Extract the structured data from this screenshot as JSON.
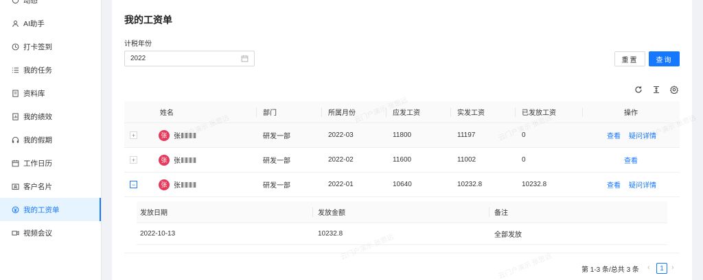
{
  "sidebar": {
    "items": [
      {
        "label": "动态",
        "icon": "activity-icon"
      },
      {
        "label": "AI助手",
        "icon": "user-icon"
      },
      {
        "label": "打卡签到",
        "icon": "clock-icon"
      },
      {
        "label": "我的任务",
        "icon": "list-icon"
      },
      {
        "label": "资料库",
        "icon": "document-icon"
      },
      {
        "label": "我的绩效",
        "icon": "report-icon"
      },
      {
        "label": "我的假期",
        "icon": "headphone-icon"
      },
      {
        "label": "工作日历",
        "icon": "calendar-icon"
      },
      {
        "label": "客户名片",
        "icon": "card-icon"
      },
      {
        "label": "我的工资单",
        "icon": "payroll-icon"
      },
      {
        "label": "视频会议",
        "icon": "video-icon"
      }
    ],
    "active_index": 9
  },
  "page": {
    "title": "我的工资单",
    "filter_label": "计税年份",
    "year_value": "2022",
    "reset_label": "重置",
    "query_label": "查询"
  },
  "table": {
    "headers": [
      "姓名",
      "部门",
      "所属月份",
      "应发工资",
      "实发工资",
      "已发放工资",
      "操作"
    ],
    "rows": [
      {
        "avatar": "张",
        "name": "张",
        "dept": "研发一部",
        "month": "2022-03",
        "gross": "11800",
        "net": "11197",
        "paid": "0",
        "actions": [
          "查看",
          "疑问详情"
        ],
        "expanded": false
      },
      {
        "avatar": "张",
        "name": "张",
        "dept": "研发一部",
        "month": "2022-02",
        "gross": "11600",
        "net": "11002",
        "paid": "0",
        "actions": [
          "查看"
        ],
        "expanded": false
      },
      {
        "avatar": "张",
        "name": "张",
        "dept": "研发一部",
        "month": "2022-01",
        "gross": "10640",
        "net": "10232.8",
        "paid": "10232.8",
        "actions": [
          "查看",
          "疑问详情"
        ],
        "expanded": true
      }
    ],
    "expander_open": "−",
    "expander_closed": "+"
  },
  "sub_table": {
    "headers": [
      "发放日期",
      "发放金额",
      "备注"
    ],
    "row": {
      "date": "2022-10-13",
      "amount": "10232.8",
      "note": "全部发放"
    }
  },
  "pagination": {
    "summary": "第 1-3 条/总共 3 条",
    "current_page": "1",
    "prev": "‹",
    "next": "›"
  },
  "watermark": "云门户演示 张思远",
  "colors": {
    "accent": "#1677ff",
    "avatar": "#e53a5c"
  }
}
